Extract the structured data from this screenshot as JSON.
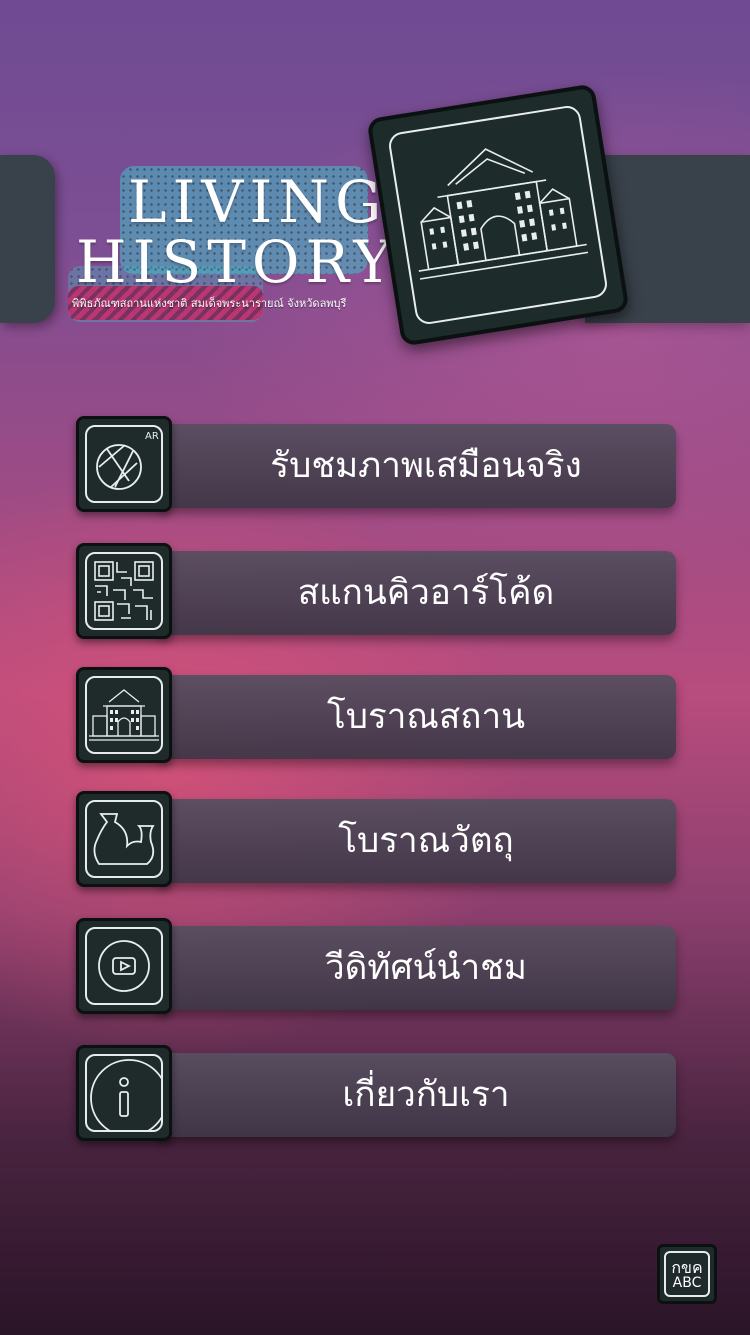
{
  "header": {
    "title_line1": "LIVING",
    "title_line2": "HISTORY",
    "subtitle": "พิพิธภัณฑสถานแห่งชาติ สมเด็จพระนารายณ์ จังหวัดลพบุรี"
  },
  "menu": [
    {
      "label": "รับชมภาพเสมือนจริง",
      "icon": "ar-camera-icon",
      "badge": "AR"
    },
    {
      "label": "สแกนคิวอาร์โค้ด",
      "icon": "qr-code-icon"
    },
    {
      "label": "โบราณสถาน",
      "icon": "palace-gate-icon"
    },
    {
      "label": "โบราณวัตถุ",
      "icon": "pottery-icon"
    },
    {
      "label": "วีดิทัศน์นำชม",
      "icon": "play-video-icon"
    },
    {
      "label": "เกี่ยวกับเรา",
      "icon": "info-icon"
    }
  ],
  "language_toggle": {
    "line1": "กขค",
    "line2": "ABC"
  },
  "colors": {
    "tile": "#1f2b2b",
    "bar": "#4e4458",
    "band": "#39414a"
  }
}
